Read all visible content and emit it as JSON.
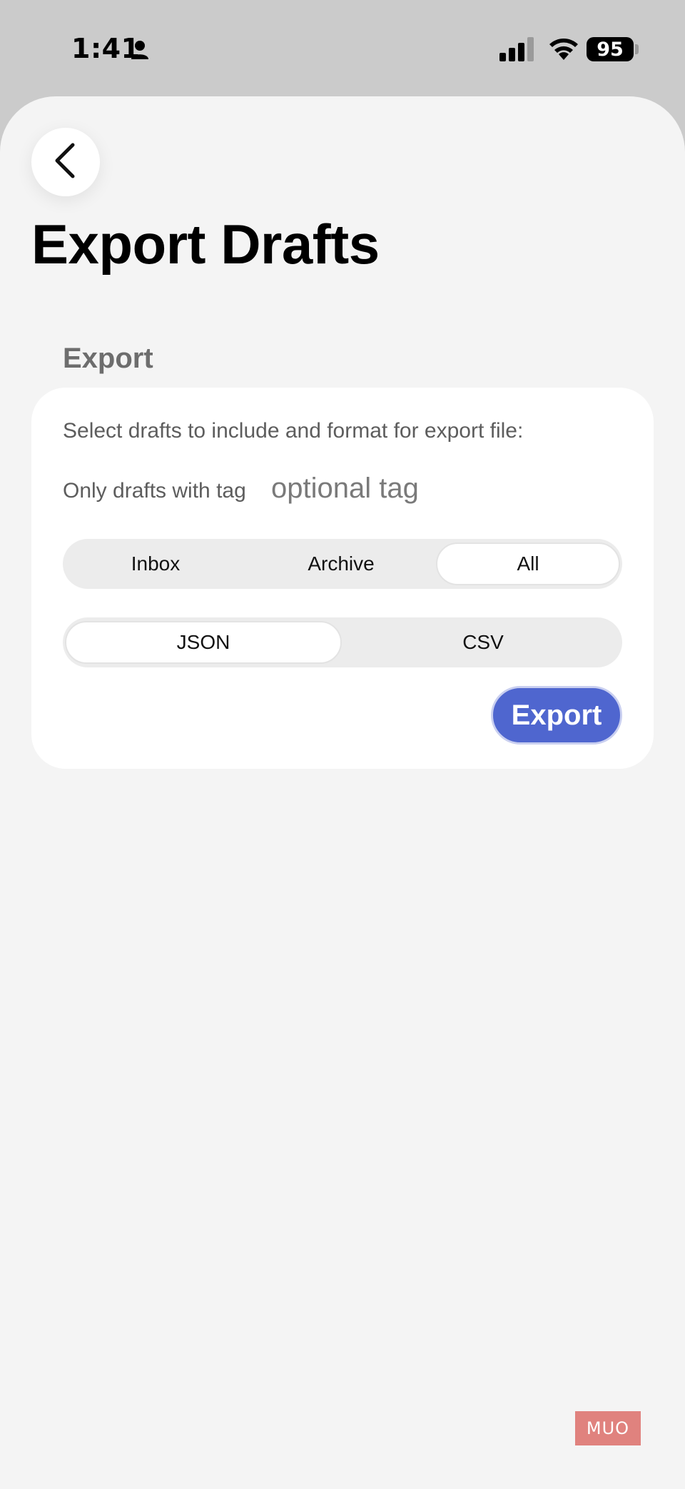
{
  "status_bar": {
    "time": "1:41",
    "battery": "95",
    "icons": [
      "person-icon",
      "signal-icon",
      "wifi-icon",
      "battery-icon"
    ]
  },
  "navigation": {
    "back_icon": "chevron-left-icon"
  },
  "page": {
    "title": "Export Drafts",
    "section_header": "Export"
  },
  "export_card": {
    "instructions": "Select drafts to include and format for export file:",
    "tag_label": "Only drafts with tag",
    "tag_placeholder": "optional tag",
    "scope_options": [
      "Inbox",
      "Archive",
      "All"
    ],
    "scope_selected": "All",
    "format_options": [
      "JSON",
      "CSV"
    ],
    "format_selected": "JSON",
    "export_button": "Export"
  },
  "colors": {
    "accent": "#4f66cf",
    "background": "#f4f4f4",
    "card": "#ffffff",
    "watermark": "#e0827e"
  },
  "watermark": {
    "text": "MUO"
  }
}
